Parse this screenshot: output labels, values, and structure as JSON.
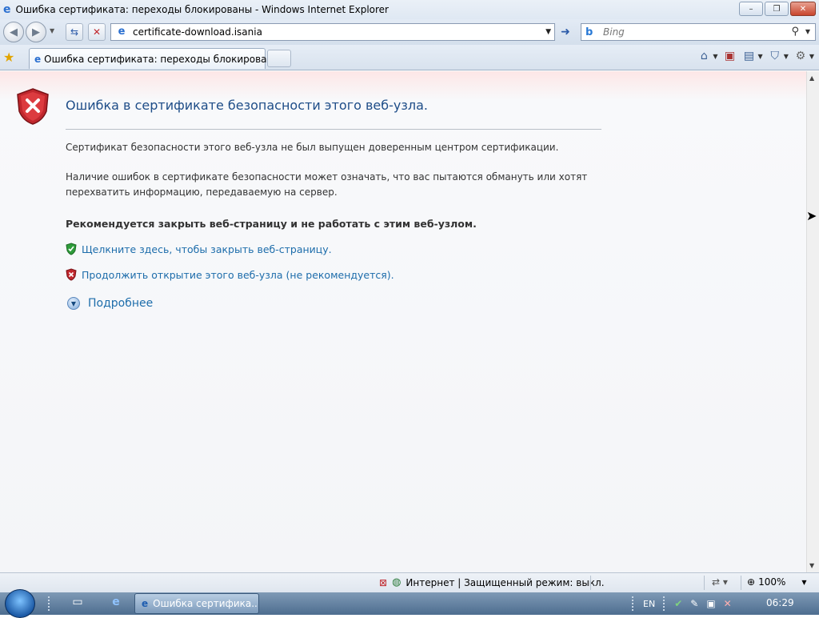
{
  "window": {
    "title": "Ошибка сертификата: переходы блокированы - Windows Internet Explorer",
    "controls": {
      "minimize": "–",
      "maximize": "❐",
      "close": "✕"
    }
  },
  "navbar": {
    "back_icon": "back-arrow-icon",
    "forward_icon": "forward-arrow-icon",
    "refresh_icon": "refresh-icon",
    "stop_icon": "stop-icon",
    "address_url": "certificate-download.isania",
    "go_icon": "go-arrow-icon",
    "search_placeholder": "Bing"
  },
  "tabs": {
    "active_label": "Ошибка сертификата: переходы блокированы"
  },
  "page": {
    "heading": "Ошибка в сертификате безопасности этого веб-узла.",
    "para1": "Сертификат безопасности этого веб-узла не был выпущен доверенным центром сертификации.",
    "para2": "Наличие ошибок в сертификате безопасности может означать, что вас пытаются обмануть или хотят перехватить информацию, передаваемую на сервер.",
    "recommend": "Рекомендуется закрыть веб-страницу и не работать с этим веб-узлом.",
    "close_link": "Щелкните здесь, чтобы закрыть веб-страницу.",
    "continue_link": "Продолжить открытие этого веб-узла (не рекомендуется).",
    "more_info": "Подробнее"
  },
  "statusbar": {
    "zone": "Интернет | Защищенный режим: выкл.",
    "zoom": "100%"
  },
  "taskbar": {
    "task_label": "Ошибка сертифика...",
    "lang": "EN",
    "clock": "06:29"
  },
  "colors": {
    "heading": "#1e4d88",
    "link": "#1d6dab",
    "error_shield": "#c0272d",
    "safe_shield": "#2e9c3a"
  }
}
